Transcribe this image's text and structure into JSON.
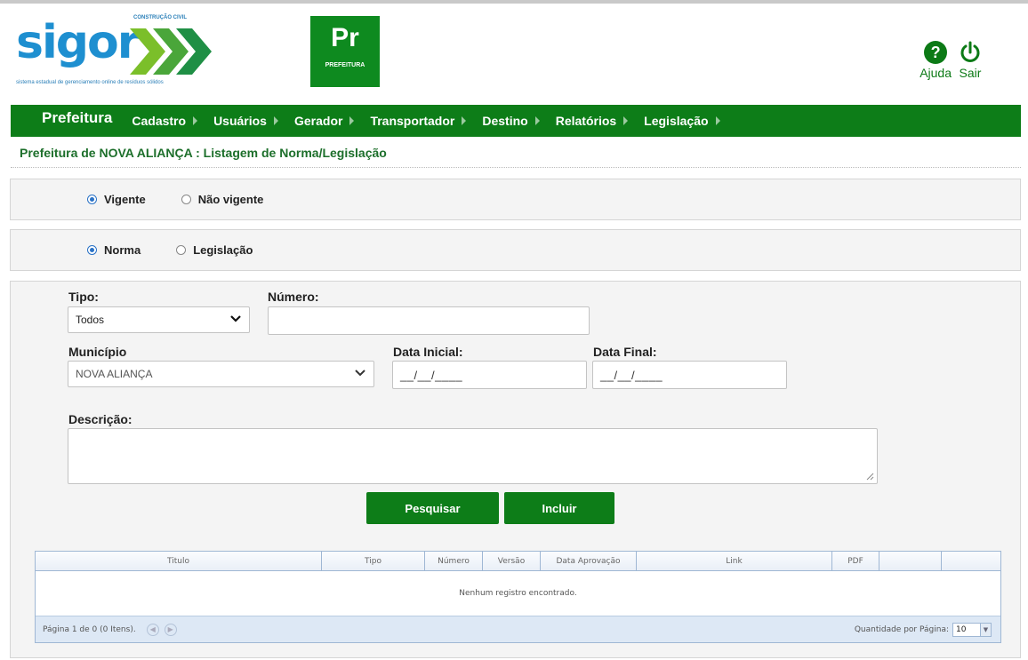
{
  "logo": {
    "name": "sigor",
    "subtitle": "CONSTRUÇÃO CIVIL",
    "tagline": "sistema estadual de gerenciamento online de resíduos sólidos"
  },
  "badge": {
    "code": "Pr",
    "label": "PREFEITURA"
  },
  "top_icons": {
    "help": "Ajuda",
    "logout": "Sair"
  },
  "nav": {
    "brand": "Prefeitura",
    "items": [
      "Cadastro",
      "Usuários",
      "Gerador",
      "Transportador",
      "Destino",
      "Relatórios",
      "Legislação"
    ]
  },
  "breadcrumb": "Prefeitura de NOVA ALIANÇA : Listagem de Norma/Legislação",
  "status_filter": {
    "option1": "Vigente",
    "option2": "Não vigente",
    "selected": "Vigente"
  },
  "type_filter": {
    "option1": "Norma",
    "option2": "Legislação",
    "selected": "Norma"
  },
  "form": {
    "tipo_label": "Tipo:",
    "tipo_value": "Todos",
    "numero_label": "Número:",
    "numero_value": "",
    "municipio_label": "Município",
    "municipio_value": "NOVA ALIANÇA",
    "data_inicial_label": "Data Inicial:",
    "data_inicial_value": "__/__/____",
    "data_final_label": "Data Final:",
    "data_final_value": "__/__/____",
    "descricao_label": "Descrição:",
    "descricao_value": ""
  },
  "buttons": {
    "search": "Pesquisar",
    "add": "Incluir"
  },
  "grid": {
    "columns": [
      "Titulo",
      "Tipo",
      "Número",
      "Versão",
      "Data Aprovação",
      "Link",
      "PDF",
      "",
      ""
    ],
    "empty_message": "Nenhum registro encontrado.",
    "pager_text": "Página 1 de 0 (0 Itens).",
    "page_size_label": "Quantidade por Página:",
    "page_size_value": "10"
  },
  "colors": {
    "primary_green": "#0d7d18",
    "logo_blue": "#1e8fd0",
    "grid_border": "#9fb7d4"
  }
}
